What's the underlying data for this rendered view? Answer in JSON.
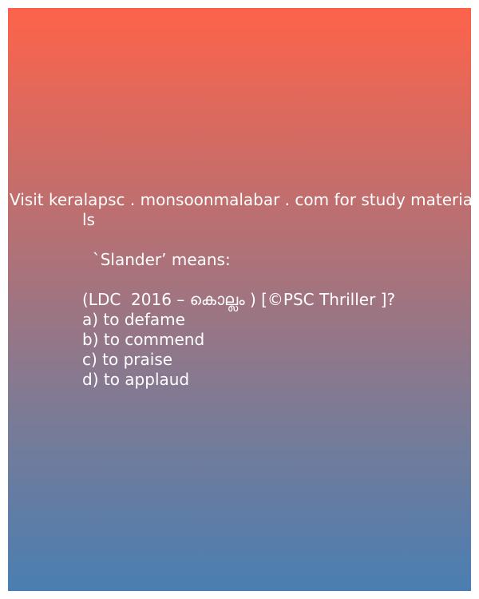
{
  "header": {
    "line1": "Visit keralapsc . monsoonmalabar . com for study materia",
    "line2": "ls"
  },
  "question": {
    "prompt": "  `Slander’ means:",
    "source": "(LDC  2016 – കൊല്ലം ) [©PSC Thriller ]?",
    "options": [
      "a) to defame",
      "b) to commend",
      "c) to praise",
      "d) to applaud"
    ]
  },
  "colors": {
    "gradient_top": "#fe634a",
    "gradient_bottom": "#4a7eb2",
    "text": "#ffffff"
  }
}
